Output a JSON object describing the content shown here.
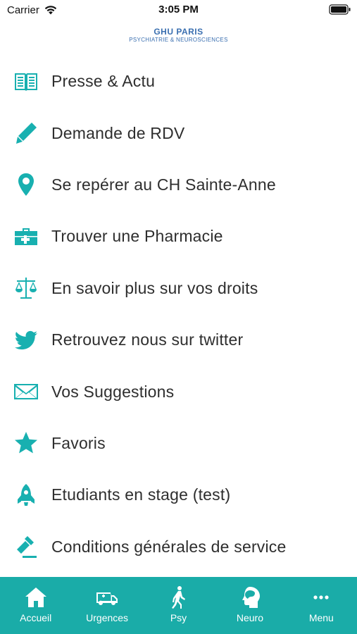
{
  "status_bar": {
    "carrier": "Carrier",
    "time": "3:05 PM"
  },
  "brand": {
    "title": "GHU PARIS",
    "subtitle": "PSYCHIATRIE & NEUROSCIENCES",
    "color": "#3a6fb0"
  },
  "accent_color": "#18b0b0",
  "menu": {
    "items": [
      {
        "label": "Presse & Actu",
        "icon": "newspaper-icon"
      },
      {
        "label": "Demande de RDV",
        "icon": "pencil-icon"
      },
      {
        "label": "Se repérer au CH Sainte-Anne",
        "icon": "map-pin-icon"
      },
      {
        "label": "Trouver une Pharmacie",
        "icon": "medical-kit-icon"
      },
      {
        "label": "En savoir plus sur vos droits",
        "icon": "scales-icon"
      },
      {
        "label": "Retrouvez nous sur twitter",
        "icon": "twitter-icon"
      },
      {
        "label": "Vos Suggestions",
        "icon": "envelope-icon"
      },
      {
        "label": "Favoris",
        "icon": "star-icon"
      },
      {
        "label": "Etudiants en stage (test)",
        "icon": "rocket-icon"
      },
      {
        "label": "Conditions générales de service",
        "icon": "gavel-icon"
      }
    ]
  },
  "tab_bar": {
    "background": "#1aaca8",
    "tabs": [
      {
        "label": "Accueil",
        "icon": "home-icon"
      },
      {
        "label": "Urgences",
        "icon": "ambulance-icon"
      },
      {
        "label": "Psy",
        "icon": "walking-person-icon"
      },
      {
        "label": "Neuro",
        "icon": "head-brain-icon"
      },
      {
        "label": "Menu",
        "icon": "more-dots-icon"
      }
    ]
  }
}
